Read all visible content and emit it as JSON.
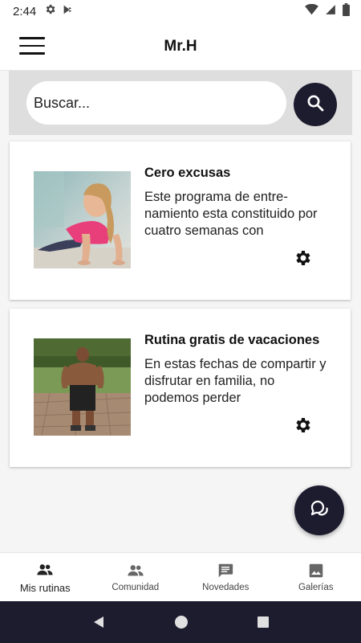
{
  "status_bar": {
    "time": "2:44",
    "icons": [
      "gear-icon",
      "play-store-icon",
      "wifi-icon",
      "signal-icon",
      "battery-icon"
    ]
  },
  "app_bar": {
    "title": "Mr.H",
    "menu_icon": "hamburger-menu-icon"
  },
  "search": {
    "placeholder": "Buscar...",
    "value": "",
    "button_icon": "search-icon"
  },
  "routines": [
    {
      "title": "Cero excusas",
      "description": "Este programa de entre-namiento esta constituido por cuatro semanas con",
      "image": "woman-doing-pushup-photo",
      "settings_icon": "gear-icon"
    },
    {
      "title": "Rutina gratis de vacaciones",
      "description": "En estas fechas de compartir y disfrutar en familia, no podemos perder",
      "image": "muscular-man-outdoor-photo",
      "settings_icon": "gear-icon"
    }
  ],
  "fab": {
    "icon": "chat-bubbles-icon"
  },
  "bottom_nav": [
    {
      "label": "Mis rutinas",
      "icon": "people-icon",
      "active": true
    },
    {
      "label": "Comunidad",
      "icon": "people-icon",
      "active": false
    },
    {
      "label": "Novedades",
      "icon": "message-icon",
      "active": false
    },
    {
      "label": "Galerías",
      "icon": "image-icon",
      "active": false
    }
  ],
  "system_nav": [
    "back-icon",
    "home-icon",
    "recents-icon"
  ],
  "colors": {
    "accent": "#1d1b2e",
    "background": "#f5f5f5",
    "search_band": "#dedede"
  }
}
